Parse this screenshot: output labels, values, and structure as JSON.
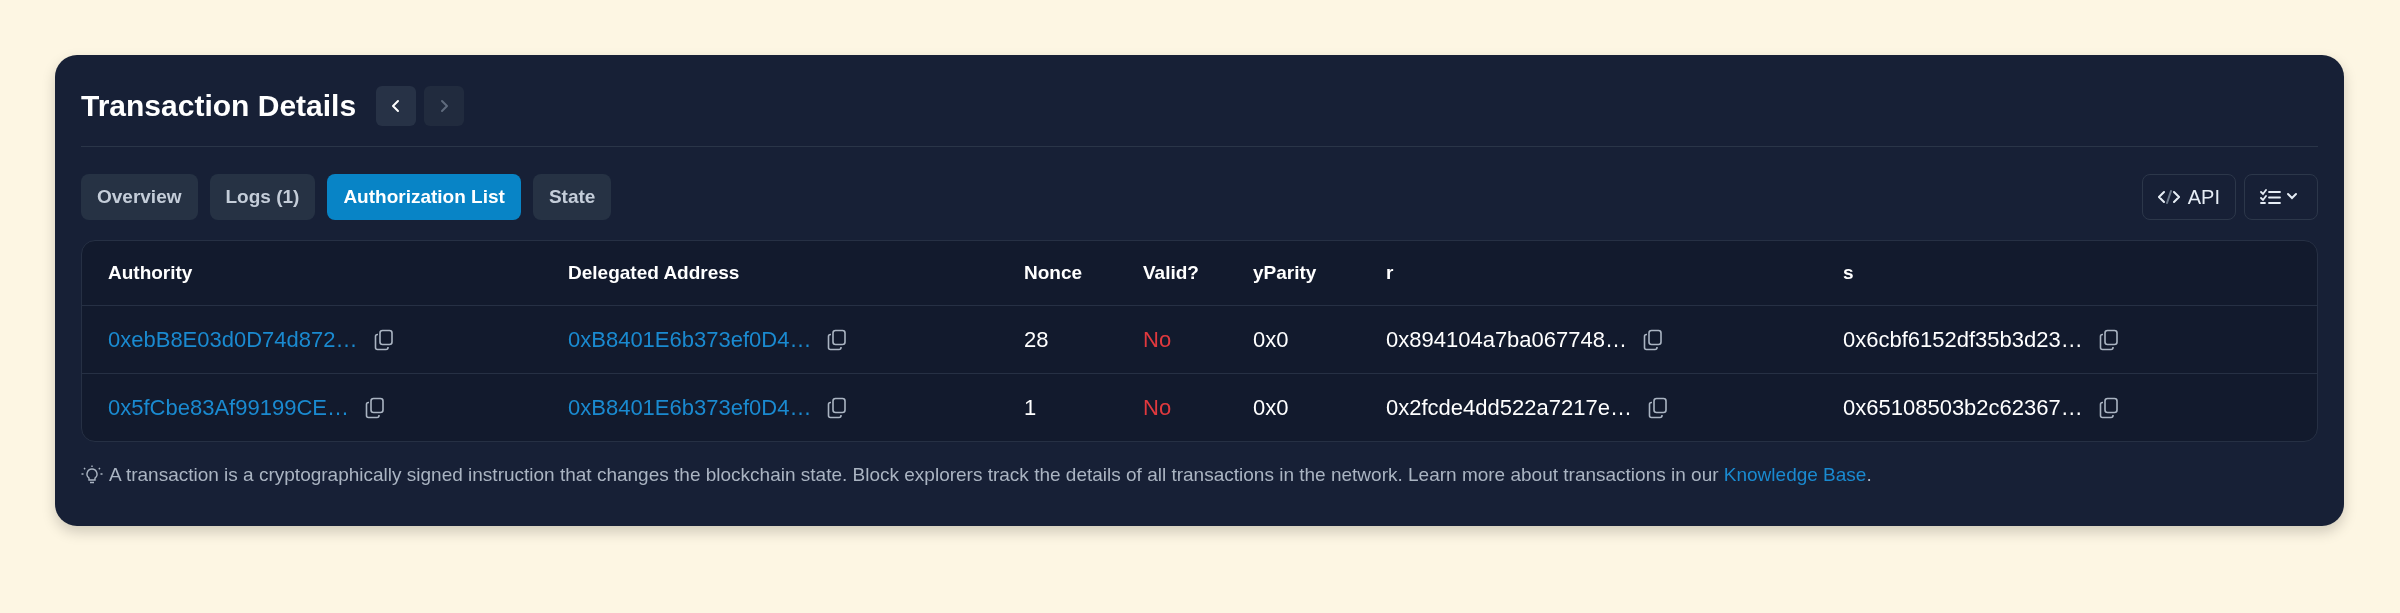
{
  "title": "Transaction Details",
  "nav": {
    "prev": {
      "disabled": false
    },
    "next": {
      "disabled": true
    }
  },
  "tabs": [
    {
      "label": "Overview",
      "selected": false
    },
    {
      "label": "Logs (1)",
      "selected": false
    },
    {
      "label": "Authorization List",
      "selected": true
    },
    {
      "label": "State",
      "selected": false
    }
  ],
  "api_button": "API",
  "table": {
    "columns": [
      "Authority",
      "Delegated Address",
      "Nonce",
      "Valid?",
      "yParity",
      "r",
      "s"
    ],
    "rows": [
      {
        "authority": "0xebB8E03d0D74d872…",
        "delegated_address": "0xB8401E6b373ef0D4…",
        "nonce": "28",
        "valid": {
          "text": "No",
          "valid": false
        },
        "yparity": "0x0",
        "r": "0x894104a7ba067748…",
        "s": "0x6cbf6152df35b3d23…"
      },
      {
        "authority": "0x5fCbe83Af99199CE…",
        "delegated_address": "0xB8401E6b373ef0D4…",
        "nonce": "1",
        "valid": {
          "text": "No",
          "valid": false
        },
        "yparity": "0x0",
        "r": "0x2fcde4dd522a7217e…",
        "s": "0x65108503b2c62367…"
      }
    ]
  },
  "footer": {
    "text": "A transaction is a cryptographically signed instruction that changes the blockchain state. Block explorers track the details of all transactions in the network. Learn more about transactions in our",
    "link": "Knowledge Base",
    "end": "."
  }
}
